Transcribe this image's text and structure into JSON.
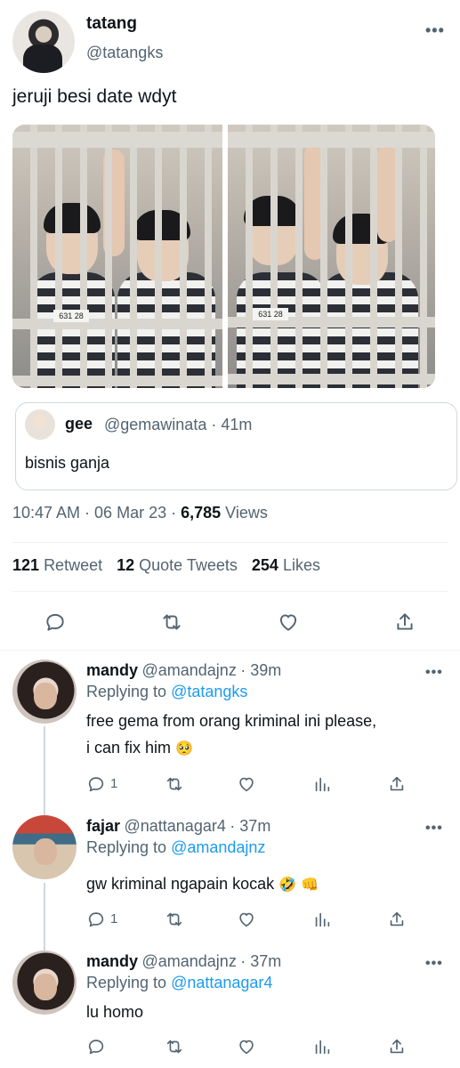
{
  "tweet": {
    "name": "tatang",
    "handle": "@tatangks",
    "more": "•••",
    "text": "jeruji besi date wdyt",
    "photo_plate_1": "631 28",
    "photo_plate_2": "631 28",
    "quote": {
      "name": "gee",
      "handle": "@gemawinata",
      "time": "· 41m",
      "text": "bisnis ganja"
    },
    "timestamp": "10:47 AM · 06 Mar 23 · ",
    "views_count": "6,785",
    "views_label": " Views",
    "stats": {
      "retweets_count": "121",
      "retweets_label": "Retweet",
      "quotes_count": "12",
      "quotes_label": "Quote Tweets",
      "likes_count": "254",
      "likes_label": "Likes"
    }
  },
  "replies": [
    {
      "name": "mandy",
      "handle": "@amandajnz",
      "time": "· 39m",
      "replying_label": "Replying to",
      "replying_to": "@tatangks",
      "text_line1": "free gema from orang kriminal ini please,",
      "text_line2": "i can fix him",
      "emoji": "🥺",
      "reply_count": "1",
      "more": "•••"
    },
    {
      "name": "fajar",
      "handle": "@nattanagar4",
      "time": "· 37m",
      "replying_label": "Replying to",
      "replying_to": "@amandajnz",
      "text_line1": "gw kriminal ngapain kocak",
      "emoji": "🤣 👊",
      "reply_count": "1",
      "more": "•••"
    },
    {
      "name": "mandy",
      "handle": "@amandajnz",
      "time": "· 37m",
      "replying_label": "Replying to",
      "replying_to": "@nattanagar4",
      "text_line1": "lu homo",
      "reply_count": "",
      "more": "•••"
    }
  ],
  "icons": {
    "reply": "reply-icon",
    "retweet": "retweet-icon",
    "like": "heart-icon",
    "share": "share-icon",
    "views": "views-icon"
  },
  "colors": {
    "link": "#1d9bf0",
    "muted": "#536471",
    "text": "#0f1419"
  }
}
